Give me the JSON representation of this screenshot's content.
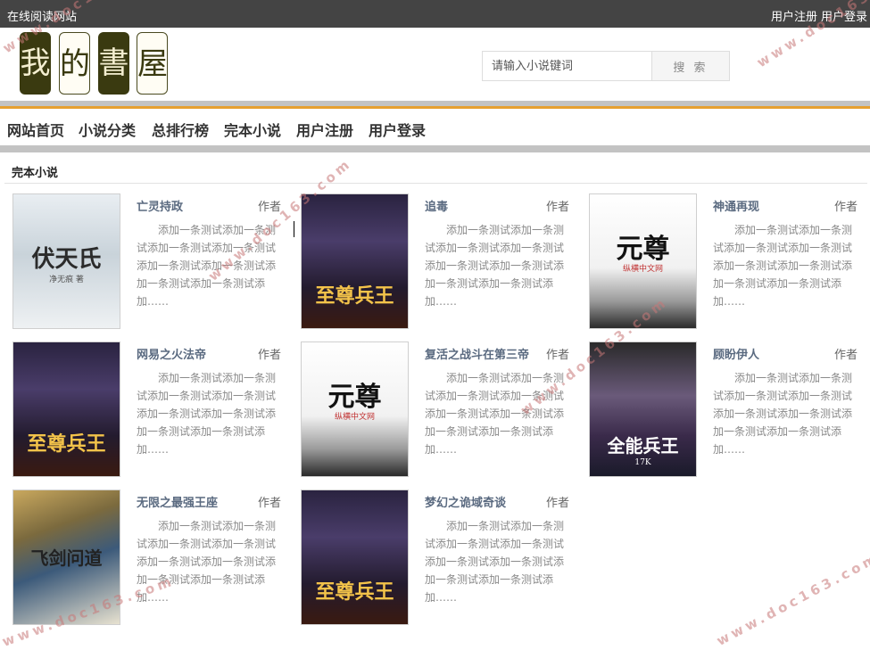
{
  "topbar": {
    "site_name": "在线阅读网站",
    "register": "用户注册",
    "login": "用户登录"
  },
  "logo": {
    "chars": [
      "我",
      "的",
      "書",
      "屋"
    ]
  },
  "search": {
    "placeholder": "请输入小说键词",
    "button": "搜 索"
  },
  "nav": [
    "网站首页",
    "小说分类",
    "总排行榜",
    "完本小说",
    "用户注册",
    "用户登录"
  ],
  "section": {
    "title": "完本小说"
  },
  "books": [
    {
      "title": "亡灵持政",
      "author": "作者",
      "cover_text": "伏天氏",
      "cover_sub": "净无痕 著",
      "cover_style": "misty",
      "desc": "添加一条测试添加一条测试添加一条测试添加一条测试添加一条测试添加一条测试添加一条测试添加一条测试添加……"
    },
    {
      "title": "追毒",
      "author": "作者",
      "cover_text": "至尊兵王",
      "cover_sub": "",
      "cover_style": "hero",
      "desc": "添加一条测试添加一条测试添加一条测试添加一条测试添加一条测试添加一条测试添加一条测试添加一条测试添加……"
    },
    {
      "title": "神通再现",
      "author": "作者",
      "cover_text": "元尊",
      "cover_sub": "纵横中文网",
      "cover_style": "ink",
      "desc": "添加一条测试添加一条测试添加一条测试添加一条测试添加一条测试添加一条测试添加一条测试添加一条测试添加……"
    },
    {
      "title": "网易之火法帝",
      "author": "作者",
      "cover_text": "至尊兵王",
      "cover_sub": "",
      "cover_style": "hero",
      "desc": "添加一条测试添加一条测试添加一条测试添加一条测试添加一条测试添加一条测试添加一条测试添加一条测试添加……"
    },
    {
      "title": "复活之战斗在第三帝",
      "author": "作者",
      "cover_text": "元尊",
      "cover_sub": "纵横中文网",
      "cover_style": "ink",
      "desc": "添加一条测试添加一条测试添加一条测试添加一条测试添加一条测试添加一条测试添加一条测试添加一条测试添加……"
    },
    {
      "title": "顾盼伊人",
      "author": "作者",
      "cover_text": "全能兵王",
      "cover_sub": "17K",
      "cover_style": "urban",
      "desc": "添加一条测试添加一条测试添加一条测试添加一条测试添加一条测试添加一条测试添加一条测试添加一条测试添加……"
    },
    {
      "title": "无限之最强王座",
      "author": "作者",
      "cover_text": "飞剑问道",
      "cover_sub": "",
      "cover_style": "dragon",
      "desc": "添加一条测试添加一条测试添加一条测试添加一条测试添加一条测试添加一条测试添加一条测试添加一条测试添加……"
    },
    {
      "title": "梦幻之诡域奇谈",
      "author": "作者",
      "cover_text": "至尊兵王",
      "cover_sub": "",
      "cover_style": "hero",
      "desc": "添加一条测试添加一条测试添加一条测试添加一条测试添加一条测试添加一条测试添加一条测试添加一条测试添加……"
    }
  ],
  "watermark": "www.doc163.com",
  "colors": {
    "topbar": "#444444",
    "accent_orange": "#e6a030",
    "band_gray": "#c3c3c3",
    "title_link": "#5a6a80"
  }
}
